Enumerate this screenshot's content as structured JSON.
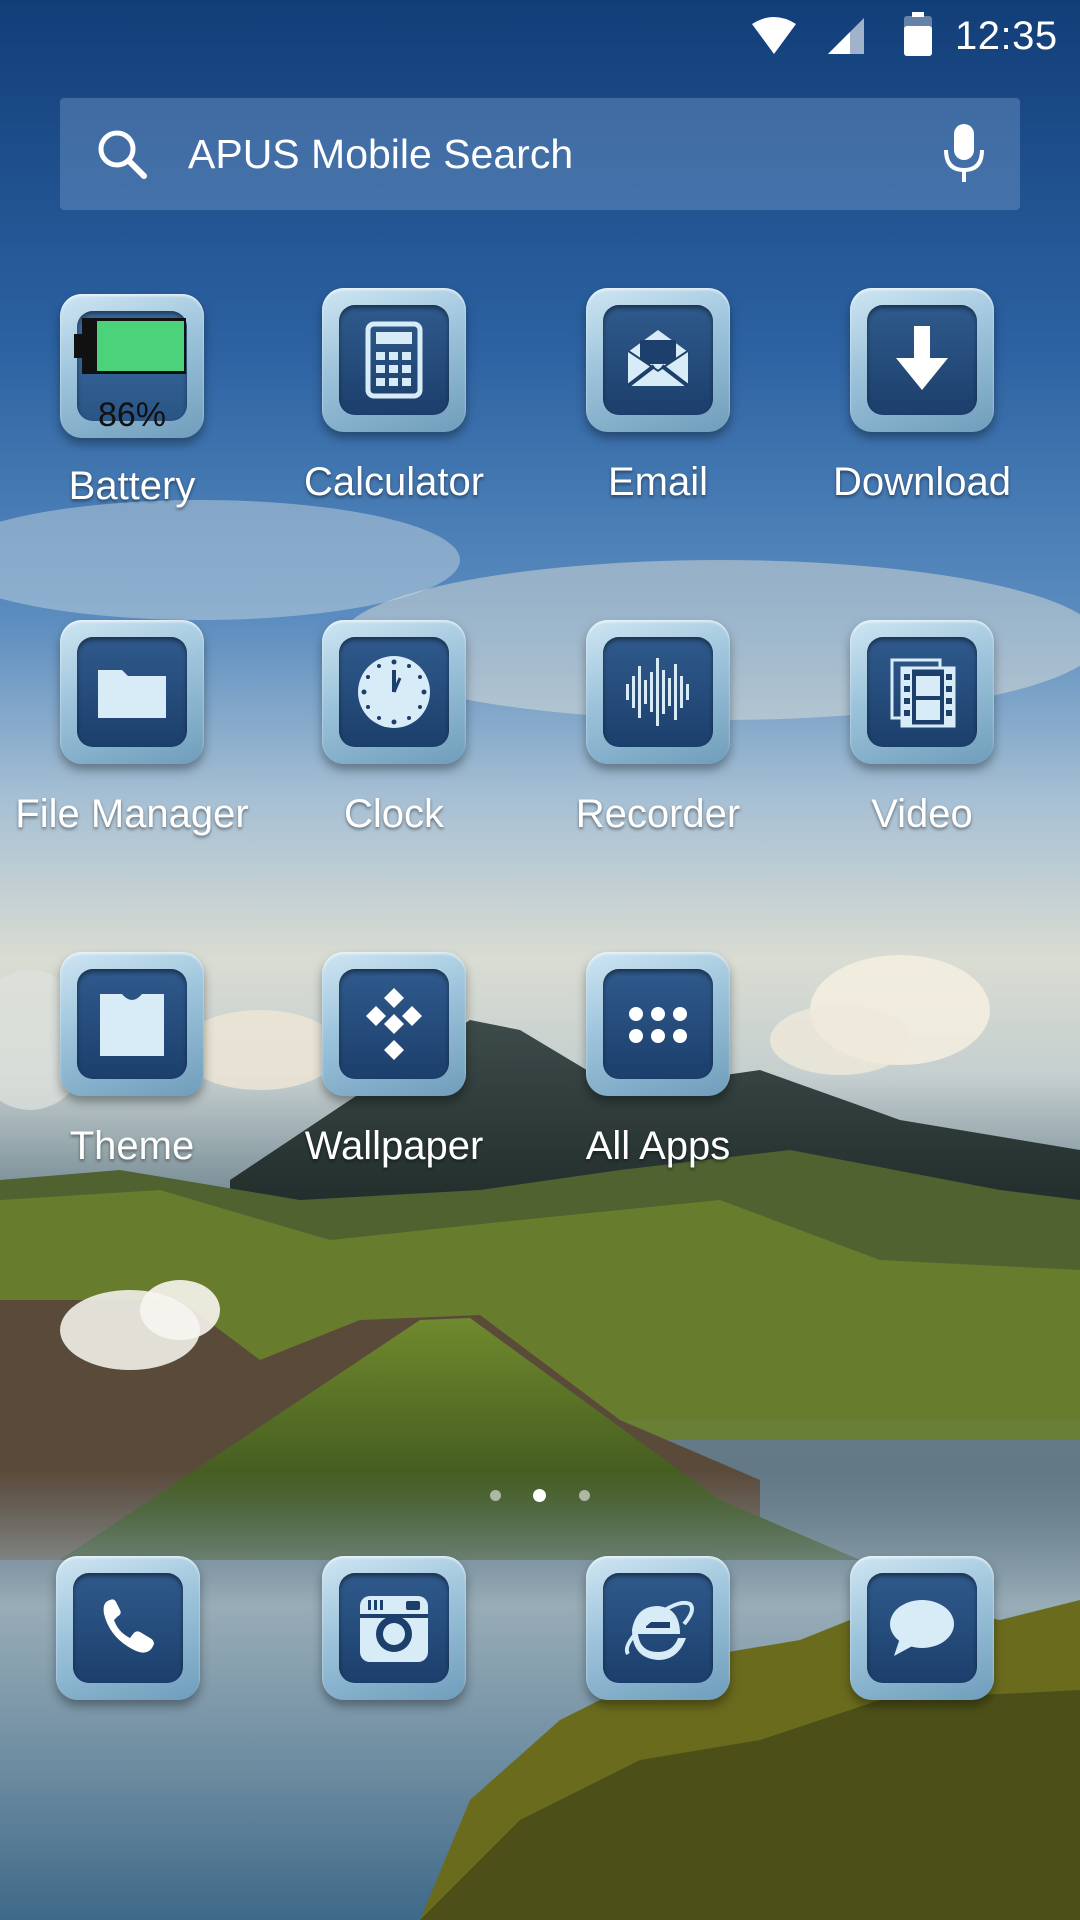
{
  "status_bar": {
    "time": "12:35",
    "icons": [
      "wifi-icon",
      "signal-icon",
      "battery-icon"
    ]
  },
  "search": {
    "placeholder": "APUS Mobile Search",
    "icon": "search-icon",
    "voice_icon": "mic-icon"
  },
  "apps": [
    {
      "label": "Battery",
      "icon": "battery-icon",
      "percent": "86%",
      "level": 0.86
    },
    {
      "label": "Calculator",
      "icon": "calculator-icon"
    },
    {
      "label": "Email",
      "icon": "envelope-icon"
    },
    {
      "label": "Download",
      "icon": "download-arrow-icon"
    },
    {
      "label": "File Manager",
      "icon": "folder-icon"
    },
    {
      "label": "Clock",
      "icon": "clock-icon"
    },
    {
      "label": "Recorder",
      "icon": "waveform-icon"
    },
    {
      "label": "Video",
      "icon": "film-icon"
    },
    {
      "label": "Theme",
      "icon": "shirt-icon"
    },
    {
      "label": "Wallpaper",
      "icon": "diamond-grid-icon"
    },
    {
      "label": "All Apps",
      "icon": "app-grid-icon"
    }
  ],
  "page_indicator": {
    "pages": 3,
    "current": 2
  },
  "dock": [
    {
      "icon": "phone-icon"
    },
    {
      "icon": "camera-icon"
    },
    {
      "icon": "browser-icon"
    },
    {
      "icon": "message-bubble-icon"
    }
  ],
  "colors": {
    "tile_inner": "#1c3f6c",
    "tile_frame": "#9cc3db",
    "battery_fill": "#4cd27a"
  }
}
